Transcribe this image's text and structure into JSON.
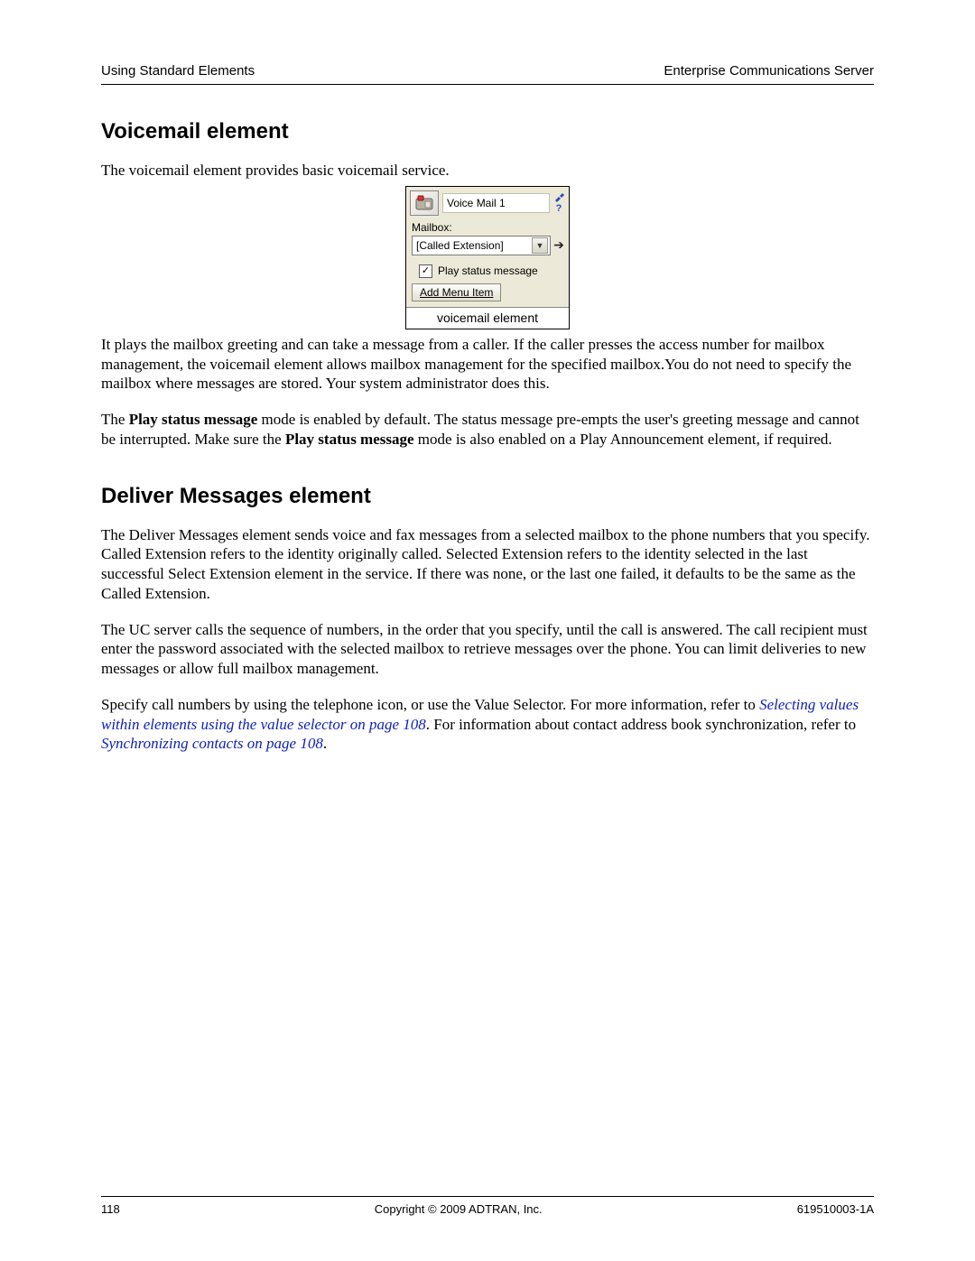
{
  "header": {
    "left": "Using Standard Elements",
    "right": "Enterprise Communications Server"
  },
  "section1": {
    "heading": "Voicemail element",
    "intro": "The voicemail element provides basic voicemail service."
  },
  "figure": {
    "title_text": "Voice Mail 1",
    "mailbox_label": "Mailbox:",
    "select_value": "[Called Extension]",
    "checkbox_label": "Play status message",
    "add_button": "Add Menu Item",
    "caption": "voicemail element"
  },
  "section1_rest": {
    "p2": "It plays the mailbox greeting and can take a message from a caller. If the caller presses the access number for mailbox management, the voicemail element allows mailbox management for the specified mailbox.You do not need to specify the mailbox where messages are stored. Your system administrator does this.",
    "p3a": "The ",
    "p3b": "Play status message",
    "p3c": " mode is enabled by default. The status message pre-empts the user's greeting message and cannot be interrupted. Make sure the ",
    "p3d": "Play status message",
    "p3e": " mode is also enabled on a Play Announcement element, if required."
  },
  "section2": {
    "heading": "Deliver Messages element",
    "p1": "The Deliver Messages element sends voice and fax messages from a selected mailbox to the phone numbers that you specify. Called Extension refers to the identity originally called. Selected Extension refers to the identity selected in the last successful Select Extension element in the service. If there was none, or the last one failed, it defaults to be the same as the Called Extension.",
    "p2": "The UC server calls the sequence of numbers, in the order that you specify, until the call is answered. The call recipient must enter the password associated with the selected mailbox to retrieve messages over the phone. You can limit deliveries to new messages or allow full mailbox management.",
    "p3a": "Specify call numbers by using the telephone icon, or use the Value Selector. For more information, refer to ",
    "link1": "Selecting values within elements using the value selector on page 108",
    "p3b": ". For information about contact address book synchronization, refer to ",
    "link2": "Synchronizing contacts on page 108",
    "p3c": "."
  },
  "footer": {
    "page": "118",
    "center": "Copyright © 2009 ADTRAN, Inc.",
    "right": "619510003-1A"
  }
}
